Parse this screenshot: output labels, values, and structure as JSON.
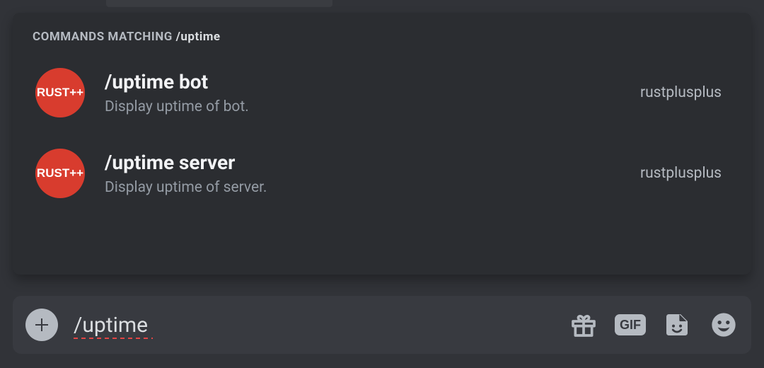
{
  "colors": {
    "avatar_bg": "#d83c2e",
    "panel_bg": "#2b2d31",
    "input_bg": "#383a40"
  },
  "header": {
    "prefix": "Commands matching ",
    "term": "/uptime"
  },
  "commands": [
    {
      "avatar_label": "RUST++",
      "name": "/uptime bot",
      "description": "Display uptime of bot.",
      "source": "rustplusplus"
    },
    {
      "avatar_label": "RUST++",
      "name": "/uptime server",
      "description": "Display uptime of server.",
      "source": "rustplusplus"
    }
  ],
  "input": {
    "value": "/uptime",
    "gif_label": "GIF"
  }
}
